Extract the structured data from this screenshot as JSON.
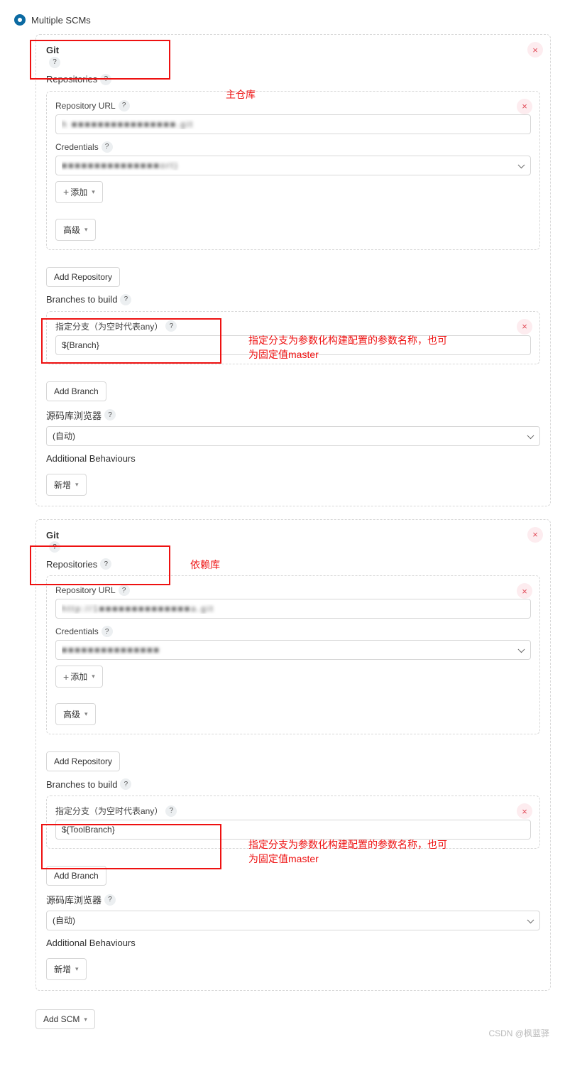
{
  "scm_type_label": "Multiple SCMs",
  "git1": {
    "title": "Git",
    "repositories_label": "Repositories",
    "repo_url_label": "Repository URL",
    "repo_url_value": "h ■■■■■■■■■■■■■■■■.git",
    "credentials_label": "Credentials",
    "credentials_value": "■■■■■■■■■■■■■■■ort)",
    "add_btn": "添加",
    "advanced_btn": "高级",
    "add_repo_btn": "Add Repository",
    "branches_label": "Branches to build",
    "branch_spec_label": "指定分支（为空时代表any）",
    "branch_spec_value": "${Branch}",
    "add_branch_btn": "Add Branch",
    "browser_label": "源码库浏览器",
    "browser_value": "(自动)",
    "behaviours_label": "Additional Behaviours",
    "behaviours_btn": "新增"
  },
  "git2": {
    "title": "Git",
    "repositories_label": "Repositories",
    "repo_url_label": "Repository URL",
    "repo_url_value": "http://1■■■■■■■■■■■■■■a.git",
    "credentials_label": "Credentials",
    "credentials_value": "■■■■■■■■■■■■■■■",
    "add_btn": "添加",
    "advanced_btn": "高级",
    "add_repo_btn": "Add Repository",
    "branches_label": "Branches to build",
    "branch_spec_label": "指定分支（为空时代表any）",
    "branch_spec_value": "${ToolBranch}",
    "add_branch_btn": "Add Branch",
    "browser_label": "源码库浏览器",
    "browser_value": "(自动)",
    "behaviours_label": "Additional Behaviours",
    "behaviours_btn": "新增"
  },
  "add_scm_btn": "Add SCM",
  "annotations": {
    "main_repo": "主仓库",
    "dep_repo": "依赖库",
    "branch_note": "指定分支为参数化构建配置的参数名称，也可为固定值master"
  },
  "watermark": "CSDN @枫蓝驿"
}
